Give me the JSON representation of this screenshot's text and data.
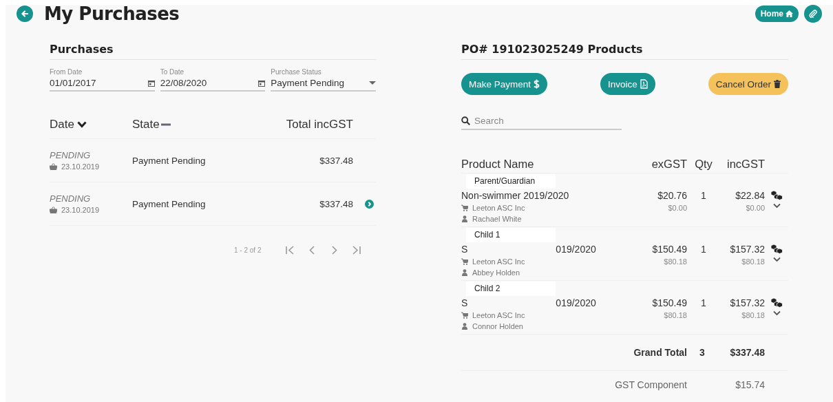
{
  "header": {
    "title": "My Purchases",
    "home_button": "Home"
  },
  "purchases": {
    "title": "Purchases",
    "filters": [
      {
        "kind": "date",
        "label": "From Date",
        "value": "01/01/2017"
      },
      {
        "kind": "date",
        "label": "To Date",
        "value": "22/08/2020"
      },
      {
        "kind": "select",
        "label": "Purchase Status",
        "value": "Payment Pending"
      }
    ],
    "columns": [
      {
        "label": "Date",
        "kind": "sorted"
      },
      {
        "label": "State",
        "kind": "unsorted"
      },
      {
        "label": "Total incGST",
        "kind": "plain"
      }
    ],
    "rows": [
      {
        "status": "PENDING",
        "date": "23.10.2019",
        "state": "Payment Pending",
        "total": "$337.48",
        "selected": false
      },
      {
        "status": "PENDING",
        "date": "23.10.2019",
        "state": "Payment Pending",
        "total": "$337.48",
        "selected": true
      }
    ],
    "pagination": "1 - 2 of 2"
  },
  "order": {
    "title": "PO# 191023025249 Products",
    "buttons": [
      {
        "kind": "pay",
        "label": "Make Payment"
      },
      {
        "kind": "invoice",
        "label": "Invoice"
      },
      {
        "kind": "cancel",
        "label": "Cancel Order"
      }
    ],
    "search": {
      "placeholder": "Search"
    },
    "columns": [
      "Product Name",
      "exGST",
      "Qty",
      "incGST"
    ],
    "products": [
      {
        "name_parts": [
          "Non-swimmer 2019/2020"
        ],
        "overlay_label": "Parent/Guardian",
        "club": "Leeton ASC Inc",
        "member": "Rachael White",
        "ex_gst": "$20.76",
        "ex_gst_sub": "$0.00",
        "qty": "1",
        "inc_gst": "$22.84",
        "inc_gst_sub": "$0.00",
        "expanded": false
      },
      {
        "name_parts": [
          "S",
          "019/2020"
        ],
        "overlay_label": "Child 1",
        "club": "Leeton ASC Inc",
        "member": "Abbey Holden",
        "ex_gst": "$150.49",
        "ex_gst_sub": "$80.18",
        "qty": "1",
        "inc_gst": "$157.32",
        "inc_gst_sub": "$80.18",
        "expanded": false
      },
      {
        "name_parts": [
          "S",
          "019/2020"
        ],
        "overlay_label": "Child 2",
        "club": "Leeton ASC Inc",
        "member": "Connor Holden",
        "ex_gst": "$150.49",
        "ex_gst_sub": "$80.18",
        "qty": "1",
        "inc_gst": "$157.32",
        "inc_gst_sub": "$80.18",
        "expanded": false
      }
    ],
    "grand_total": {
      "label": "Grand Total",
      "qty": "3",
      "amount": "$337.48"
    },
    "gst_component": {
      "label": "GST Component",
      "amount": "$15.74"
    }
  }
}
